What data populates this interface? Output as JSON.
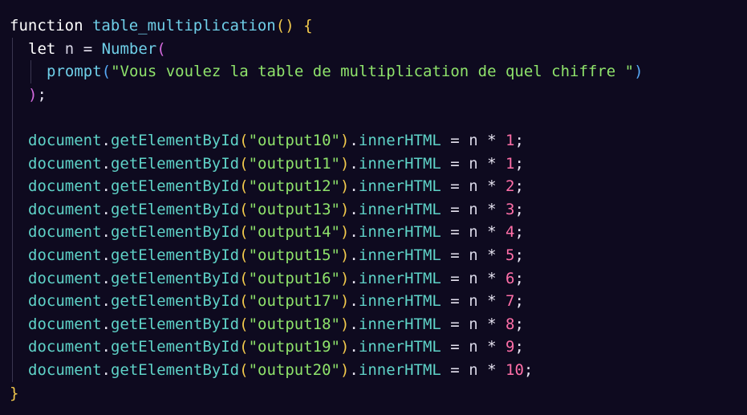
{
  "code": {
    "kw_function": "function",
    "fn_name": "table_multiplication",
    "open_paren": "(",
    "close_paren": ")",
    "open_brace": "{",
    "close_brace": "}",
    "kw_let": "let",
    "var_n": "n",
    "eq": "=",
    "number_fn": "Number",
    "prompt_fn": "prompt",
    "prompt_string": "\"Vous voulez la table de multiplication de quel chiffre \"",
    "semicolon": ";",
    "lines": [
      {
        "obj": "document",
        "method": "getElementById",
        "arg": "\"output10\"",
        "prop": "innerHTML",
        "factor": "1"
      },
      {
        "obj": "document",
        "method": "getElementById",
        "arg": "\"output11\"",
        "prop": "innerHTML",
        "factor": "1"
      },
      {
        "obj": "document",
        "method": "getElementById",
        "arg": "\"output12\"",
        "prop": "innerHTML",
        "factor": "2"
      },
      {
        "obj": "document",
        "method": "getElementById",
        "arg": "\"output13\"",
        "prop": "innerHTML",
        "factor": "3"
      },
      {
        "obj": "document",
        "method": "getElementById",
        "arg": "\"output14\"",
        "prop": "innerHTML",
        "factor": "4"
      },
      {
        "obj": "document",
        "method": "getElementById",
        "arg": "\"output15\"",
        "prop": "innerHTML",
        "factor": "5"
      },
      {
        "obj": "document",
        "method": "getElementById",
        "arg": "\"output16\"",
        "prop": "innerHTML",
        "factor": "6"
      },
      {
        "obj": "document",
        "method": "getElementById",
        "arg": "\"output17\"",
        "prop": "innerHTML",
        "factor": "7"
      },
      {
        "obj": "document",
        "method": "getElementById",
        "arg": "\"output18\"",
        "prop": "innerHTML",
        "factor": "8"
      },
      {
        "obj": "document",
        "method": "getElementById",
        "arg": "\"output19\"",
        "prop": "innerHTML",
        "factor": "9"
      },
      {
        "obj": "document",
        "method": "getElementById",
        "arg": "\"output20\"",
        "prop": "innerHTML",
        "factor": "10"
      }
    ]
  }
}
